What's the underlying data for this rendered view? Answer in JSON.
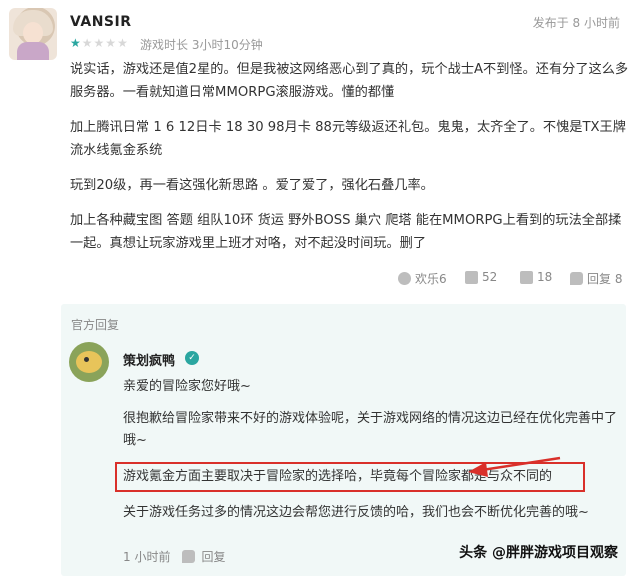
{
  "review": {
    "username": "VANSIR",
    "publish_time": "发布于 8 小时前",
    "rating": 1,
    "rating_max": 5,
    "playtime": "游戏时长 3小时10分钟",
    "paragraphs": [
      "说实话，游戏还是值2星的。但是我被这网络恶心到了真的，玩个战士A不到怪。还有分了这么多服务器。一看就知道日常MMORPG滚服游戏。懂的都懂",
      "加上腾讯日常 1 6 12日卡 18 30 98月卡 88元等级返还礼包。鬼鬼，太齐全了。不愧是TX王牌流水线氪金系统",
      "玩到20级，再一看这强化新思路 。爱了爱了，强化石叠几率。",
      "加上各种藏宝图 答题 组队10环 货运 野外BOSS 巢穴 爬塔 能在MMORPG上看到的玩法全部揉一起。真想让玩家游戏里上班才对咯，对不起没时间玩。删了"
    ],
    "actions": {
      "fun": "欢乐6",
      "like": "52",
      "dislike": "18",
      "reply": "回复 8"
    }
  },
  "official_reply": {
    "label": "官方回复",
    "dev_name": "策划疯鸭",
    "paragraphs": [
      "亲爱的冒险家您好哦~",
      "很抱歉给冒险家带来不好的游戏体验呢，关于游戏网络的情况这边已经在优化完善中了哦~",
      "游戏氪金方面主要取决于冒险家的选择哈，毕竟每个冒险家都是与众不同的",
      "关于游戏任务过多的情况这边会帮您进行反馈的哈，我们也会不断优化完善的哦~"
    ],
    "time": "1 小时前",
    "reply_label": "回复"
  },
  "watermark": "头条 @胖胖游戏项目观察",
  "colors": {
    "accent": "#2aa6a0",
    "highlight_border": "#d9302a",
    "reply_bg": "#f1f8f7"
  }
}
